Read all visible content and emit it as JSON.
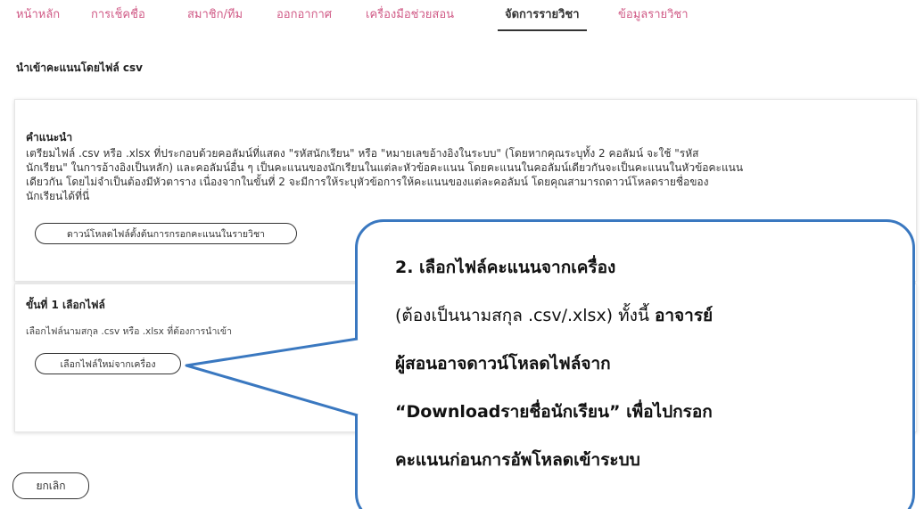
{
  "nav": {
    "items": [
      {
        "label": "หน้าหลัก"
      },
      {
        "label": "การเช็คชื่อ"
      },
      {
        "label": "สมาชิก/ทีม"
      },
      {
        "label": "ออกอากาศ"
      },
      {
        "label": "เครื่องมือช่วยสอน"
      },
      {
        "label": "จัดการรายวิชา",
        "active": true
      },
      {
        "label": "ข้อมูลรายวิชา"
      }
    ]
  },
  "page": {
    "title": "นำเข้าคะแนนโดยไฟล์ csv"
  },
  "instructions": {
    "heading": "คำแนะนำ",
    "line1": "เตรียมไฟล์ .csv หรือ .xlsx ที่ประกอบด้วยคอลัมน์ที่แสดง \"รหัสนักเรียน\" หรือ \"หมายเลขอ้างอิงในระบบ\" (โดยหากคุณระบุทั้ง 2 คอลัมน์ จะใช้ \"รหัส",
    "line2": "นักเรียน\" ในการอ้างอิงเป็นหลัก) และคอลัมน์อื่น ๆ เป็นคะแนนของนักเรียนในแต่ละหัวข้อคะแนน โดยคะแนนในคอลัมน์เดียวกันจะเป็นคะแนนในหัวข้อคะแนน",
    "line3": "เดียวกัน โดยไม่จำเป็นต้องมีหัวตาราง เนื่องจากในขั้นที่ 2 จะมีการให้ระบุหัวข้อการให้คะแนนของแต่ละคอลัมน์ โดยคุณสามารถดาวน์โหลดรายชื่อของ",
    "line4": "นักเรียนได้ที่นี่",
    "download_button": "ดาวน์โหลดไฟล์ตั้งต้นการกรอกคะแนนในรายวิชา"
  },
  "step1": {
    "title": "ขั้นที่ 1 เลือกไฟล์",
    "description": "เลือกไฟล์นามสกุล .csv หรือ .xlsx ที่ต้องการนำเข้า",
    "choose_button": "เลือกไฟล์ใหม่จากเครื่อง"
  },
  "cancel_button": "ยกเลิก",
  "callout": {
    "line1": "2. เลือกไฟล์คะแนนจากเครื่อง",
    "line2_normal": "(ต้องเป็นนามสกุล .csv/.xlsx) ทั้งนี้ ",
    "line2_bold": "อาจารย์",
    "line3": "ผู้สอนอาจดาวน์โหลดไฟล์จาก",
    "line4": "“Downloadรายชื่อนักเรียน” เพื่อไปกรอก",
    "line5": "คะแนนก่อนการอัพโหลดเข้าระบบ"
  },
  "colors": {
    "nav_link": "#d05a86",
    "nav_active": "#333333",
    "callout_border": "#3a78c0"
  }
}
